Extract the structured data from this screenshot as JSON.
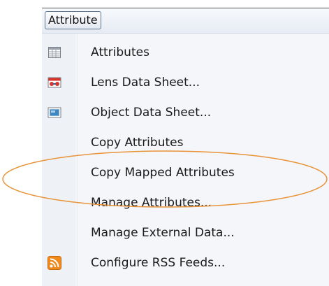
{
  "menubar": {
    "attribute_label": "Attribute"
  },
  "menu": {
    "items": [
      {
        "label": "Attributes",
        "icon": "table-icon"
      },
      {
        "label": "Lens Data Sheet...",
        "icon": "lens-data-sheet-icon"
      },
      {
        "label": "Object Data Sheet...",
        "icon": "object-data-sheet-icon"
      },
      {
        "label": "Copy Attributes",
        "icon": ""
      },
      {
        "label": "Copy Mapped Attributes",
        "icon": ""
      },
      {
        "label": "Manage Attributes...",
        "icon": ""
      },
      {
        "label": "Manage External Data...",
        "icon": ""
      },
      {
        "label": "Configure RSS Feeds...",
        "icon": "rss-icon"
      }
    ]
  },
  "colors": {
    "highlight_ellipse": "#e8943a",
    "rss_orange": "#f08a1c",
    "lens_red": "#d9342b"
  }
}
